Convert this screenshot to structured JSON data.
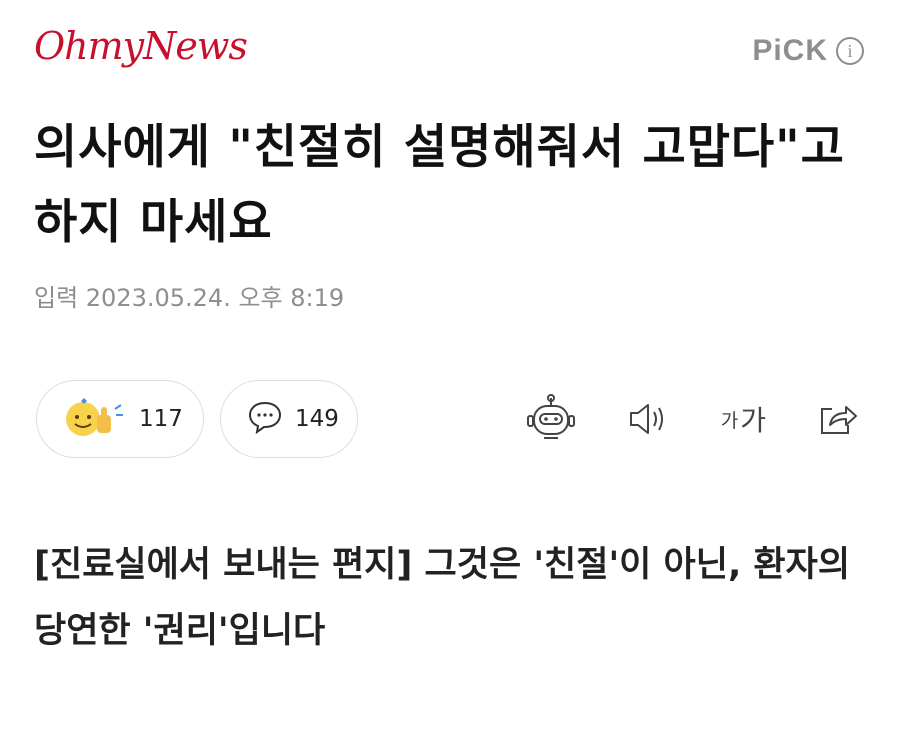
{
  "header": {
    "logo_text": "OhmyNews",
    "pick_label": "PiCK",
    "info_glyph": "i"
  },
  "article": {
    "title": "의사에게 \"친절히 설명해줘서 고맙다\"고 하지 마세요",
    "date": "입력 2023.05.24. 오후 8:19",
    "subtitle": "[진료실에서 보내는 편지] 그것은 '친절'이 아닌, 환자의 당연한 '권리'입니다"
  },
  "reactions": {
    "like_count": "117",
    "comment_count": "149"
  },
  "toolbar": {
    "font_small": "가",
    "font_large": "가",
    "icons": [
      "robot-summary-icon",
      "speaker-icon",
      "font-size-icon",
      "share-icon"
    ]
  },
  "colors": {
    "logo": "#c8102e",
    "muted": "#8e8e8e",
    "border": "#dcdcdc"
  }
}
